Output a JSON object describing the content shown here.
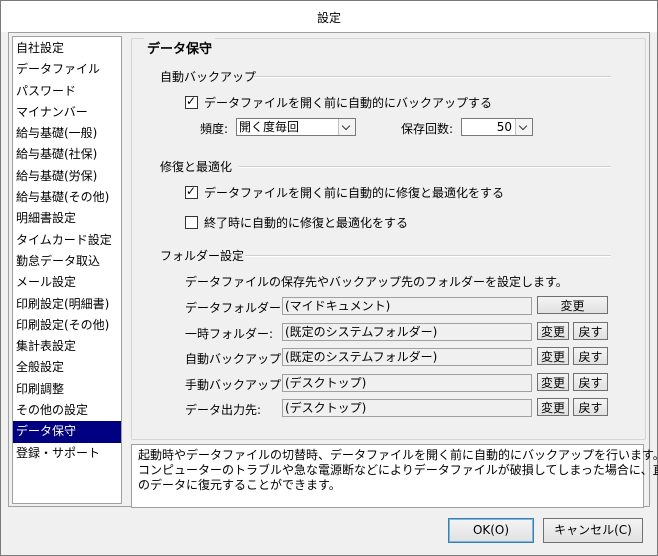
{
  "window": {
    "title": "設定"
  },
  "sidebar": {
    "items": [
      {
        "label": "自社設定"
      },
      {
        "label": "データファイル"
      },
      {
        "label": "パスワード"
      },
      {
        "label": "マイナンバー"
      },
      {
        "label": "給与基礎(一般)"
      },
      {
        "label": "給与基礎(社保)"
      },
      {
        "label": "給与基礎(労保)"
      },
      {
        "label": "給与基礎(その他)"
      },
      {
        "label": "明細書設定"
      },
      {
        "label": "タイムカード設定"
      },
      {
        "label": "勤怠データ取込"
      },
      {
        "label": "メール設定"
      },
      {
        "label": "印刷設定(明細書)"
      },
      {
        "label": "印刷設定(その他)"
      },
      {
        "label": "集計表設定"
      },
      {
        "label": "全般設定"
      },
      {
        "label": "印刷調整"
      },
      {
        "label": "その他の設定"
      },
      {
        "label": "データ保守"
      },
      {
        "label": "登録・サポート"
      }
    ],
    "selected_index": 18
  },
  "group_title": "データ保守",
  "auto_backup": {
    "heading": "自動バックアップ",
    "checkbox_label": "データファイルを開く前に自動的にバックアップする",
    "checked": true,
    "frequency_label": "頻度:",
    "frequency_value": "開く度毎回",
    "count_label": "保存回数:",
    "count_value": "50"
  },
  "repair": {
    "heading": "修復と最適化",
    "before_open_label": "データファイルを開く前に自動的に修復と最適化をする",
    "before_open_checked": true,
    "on_exit_label": "終了時に自動的に修復と最適化をする",
    "on_exit_checked": false
  },
  "folders": {
    "heading": "フォルダー設定",
    "description": "データファイルの保存先やバックアップ先のフォルダーを設定します。",
    "rows": [
      {
        "label": "データフォルダー:",
        "value": "(マイドキュメント)",
        "change": "変更",
        "revert": null
      },
      {
        "label": "一時フォルダー:",
        "value": "(既定のシステムフォルダー)",
        "change": "変更",
        "revert": "戻す"
      },
      {
        "label": "自動バックアップ:",
        "value": "(既定のシステムフォルダー)",
        "change": "変更",
        "revert": "戻す"
      },
      {
        "label": "手動バックアップ:",
        "value": "(デスクトップ)",
        "change": "変更",
        "revert": "戻す"
      },
      {
        "label": "データ出力先:",
        "value": "(デスクトップ)",
        "change": "変更",
        "revert": "戻す"
      }
    ]
  },
  "info": {
    "lines": [
      "起動時やデータファイルの切替時、データファイルを開く前に自動的にバックアップを行います。",
      "コンピューターのトラブルや急な電源断などによりデータファイルが破損してしまった場合に、直前",
      "のデータに復元することができます。"
    ]
  },
  "footer": {
    "ok_label": "OK(O)",
    "cancel_label": "キャンセル(C)"
  }
}
